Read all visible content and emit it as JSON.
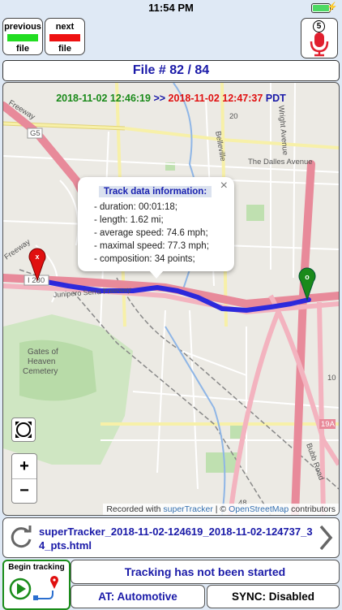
{
  "status_bar": {
    "time": "11:54 PM"
  },
  "prev_button": {
    "label_top": "previous",
    "label_bottom": "file",
    "color": "#22dd22"
  },
  "next_button": {
    "label_top": "next",
    "label_bottom": "file",
    "color": "#ee1111"
  },
  "mic_button": {
    "badge": "5"
  },
  "title": "File # 82 / 84",
  "dates": {
    "start": "2018-11-02 12:46:19",
    "separator": ">>",
    "end": "2018-11-02 12:47:37",
    "tz": "PDT"
  },
  "popup": {
    "title": "Track data information:",
    "lines": [
      "- duration: 00:01:18;",
      "- length: 1.62 mi;",
      "- average speed: 74.6 mph;",
      "- maximal speed: 77.3 mph;",
      "- composition: 34 points;"
    ],
    "close": "×"
  },
  "markers": {
    "start": "x",
    "end": "o"
  },
  "map_labels": {
    "g5": "G5",
    "freeway": "Freeway",
    "i280": "I 280",
    "junipero": "Junipero Serra Freeway",
    "gates": "Gates of Heaven Cemetery",
    "belleville": "Belleville",
    "wright": "Wright Avenue",
    "dalles": "The Dalles Avenue",
    "bubb": "Bubb Road",
    "r19a": "19A",
    "r20": "20",
    "r10": "10",
    "r48": "48"
  },
  "zoom": {
    "in": "+",
    "out": "−"
  },
  "attribution": {
    "prefix": "Recorded with ",
    "link1": "superTracker",
    "mid": " | © ",
    "link2": "OpenStreetMap",
    "suffix": " contributors"
  },
  "filename": "superTracker_2018-11-02-124619_2018-11-02-124737_34_pts.html",
  "begin_tracking": "Begin tracking",
  "tracking_status": "Tracking has not been started",
  "at_mode": "AT: Automotive",
  "sync": "SYNC: Disabled",
  "colors": {
    "accent": "#1a1aa8",
    "track": "#2222dd",
    "start_marker": "#e01010",
    "end_marker": "#1a8a1a",
    "highway": "#e88a9a"
  }
}
